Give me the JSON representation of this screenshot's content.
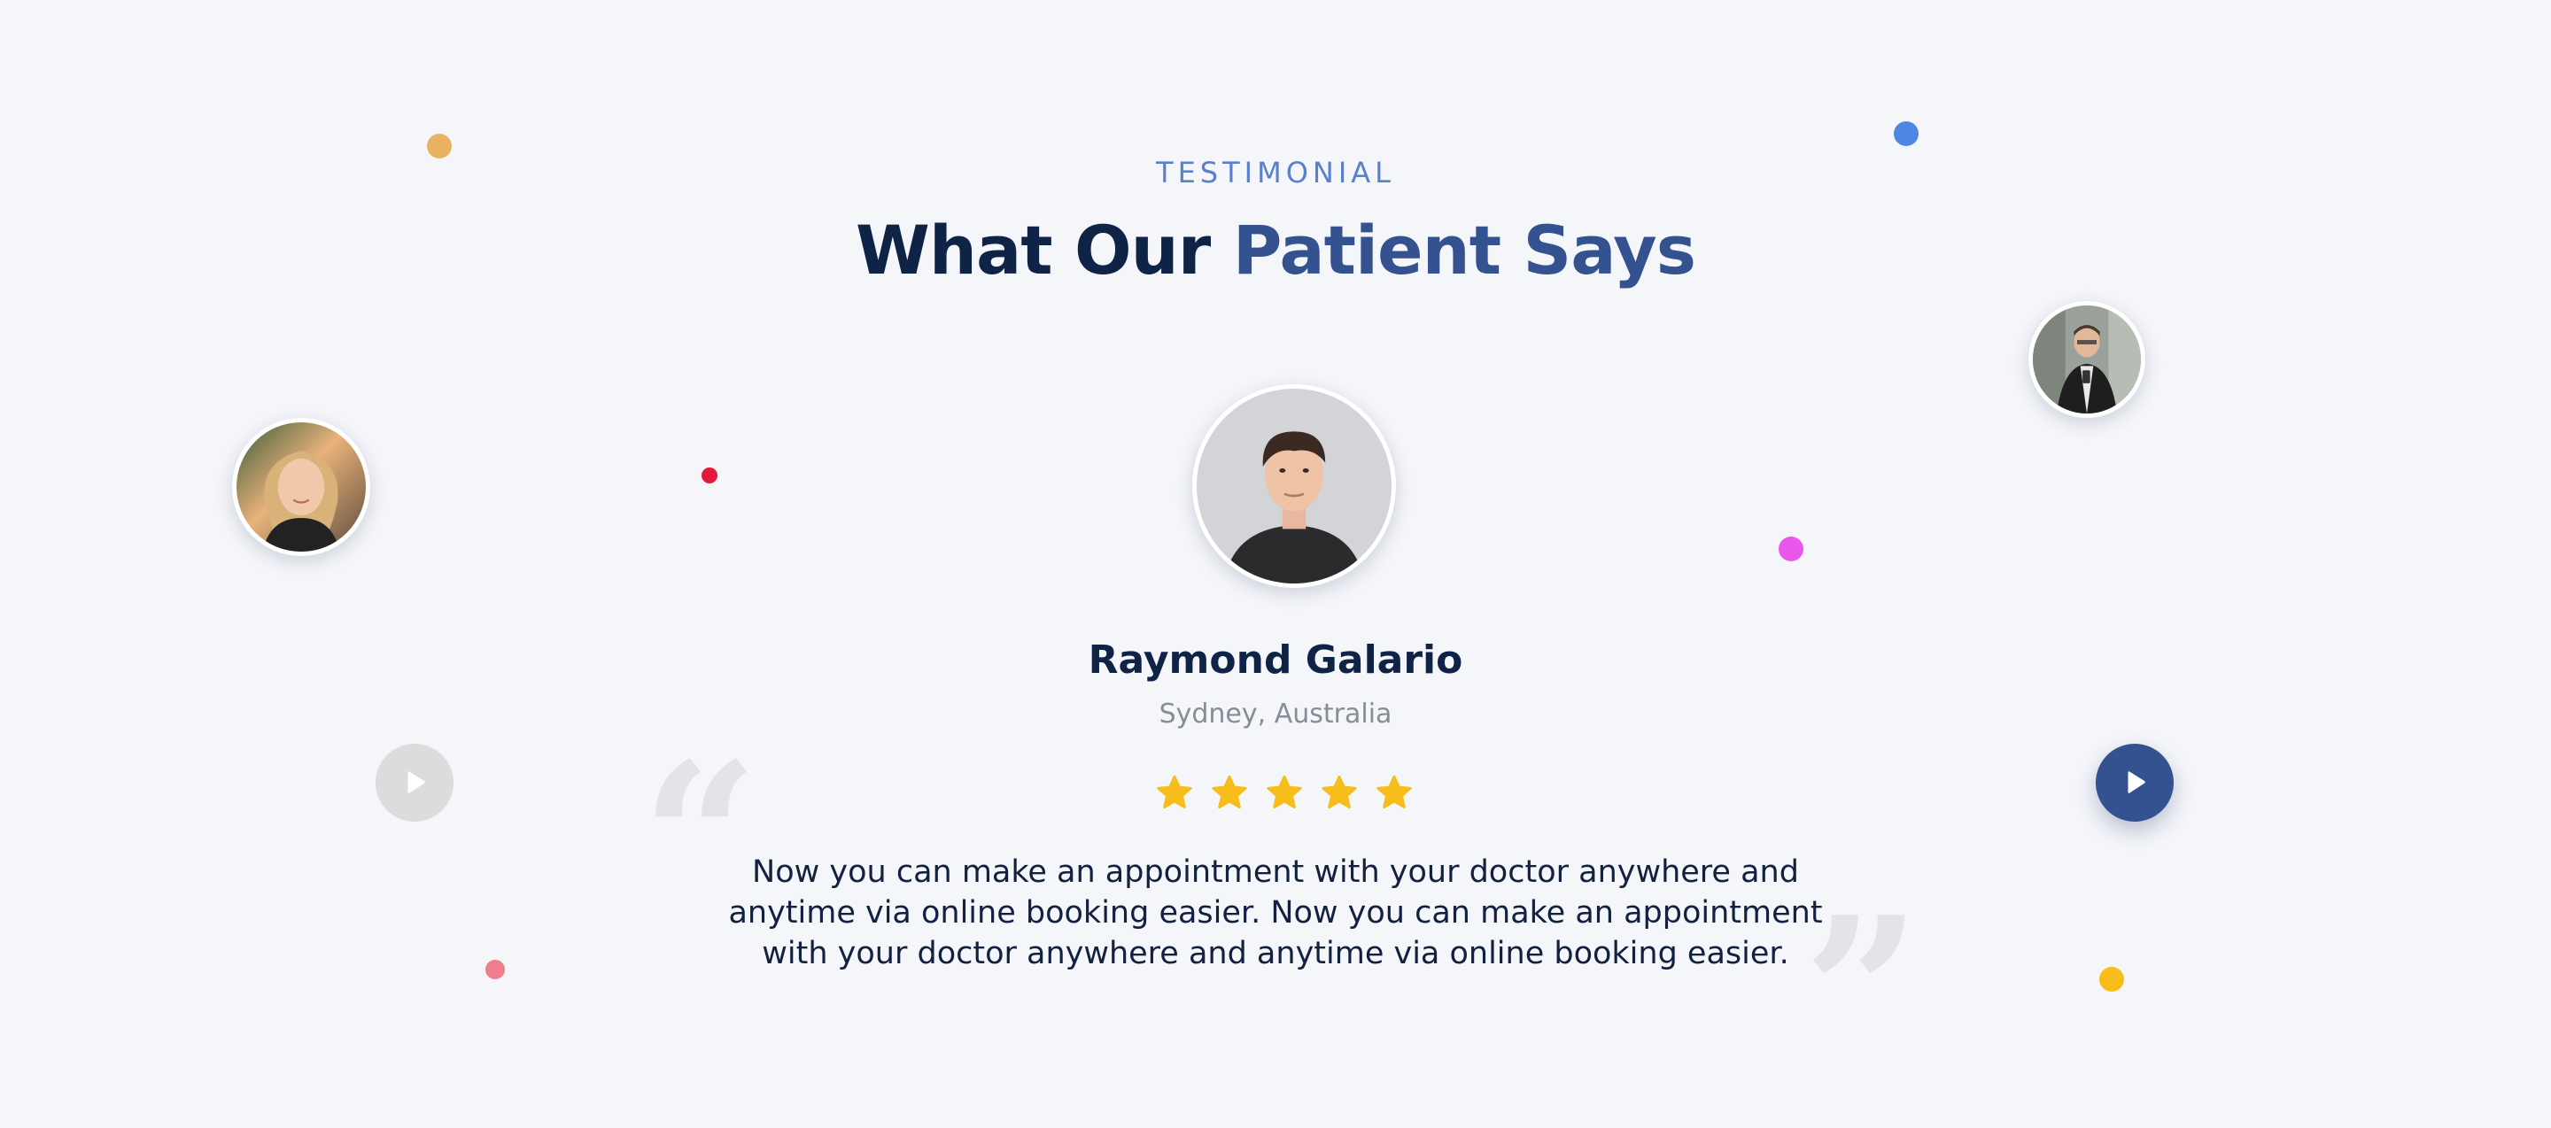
{
  "section": {
    "eyebrow": "TESTIMONIAL",
    "title_part1": "What Our ",
    "title_part2": "Patient Says"
  },
  "testimonial": {
    "name": "Raymond Galario",
    "location": "Sydney, Australia",
    "rating": 5,
    "rating_max": 5,
    "quote": "Now you can make an appointment with your doctor anywhere and anytime via online booking easier. Now you can make an appointment with your doctor anywhere and anytime via online booking easier.",
    "open_quote": "“",
    "close_quote": "”"
  },
  "controls": {
    "prev_icon": "play-icon",
    "next_icon": "play-icon"
  },
  "colors": {
    "accent": "#34528f",
    "eyebrow": "#5a7fcc",
    "heading": "#0f2346",
    "star": "#f7bd1b",
    "background": "#f5f6fa"
  }
}
